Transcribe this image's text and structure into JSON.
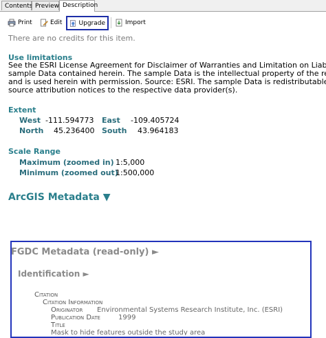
{
  "tabs": [
    {
      "label": "Contents"
    },
    {
      "label": "Preview"
    },
    {
      "label": "Description"
    }
  ],
  "toolbar": {
    "print": "Print",
    "edit": "Edit",
    "upgrade": "Upgrade",
    "import": "Import"
  },
  "credits_text": "There are no credits for this item.",
  "use_limitations": {
    "heading": "Use limitations",
    "lines": [
      "See the ESRI License Agreement for Disclaimer of Warranties and Limitation on Liabilities",
      "sample Data contained herein. The sample Data is the intellectual property of the respe",
      "and is used herein with permission. Source: ESRI. The sample Data is redistributable wit",
      "source attribution notices to the respective data provider(s)."
    ]
  },
  "extent": {
    "heading": "Extent",
    "west_label": "West",
    "west_value": "-111.594773",
    "east_label": "East",
    "east_value": "-109.405724",
    "north_label": "North",
    "north_value": "45.236400",
    "south_label": "South",
    "south_value": "43.964183"
  },
  "scale_range": {
    "heading": "Scale Range",
    "max_label": "Maximum (zoomed in)",
    "max_value": "1:5,000",
    "min_label": "Minimum (zoomed out)",
    "min_value": "1:500,000"
  },
  "arcgis_metadata": {
    "title": "ArcGIS Metadata",
    "arrow": "▼"
  },
  "fgdc": {
    "title": "FGDC Metadata (read-only)",
    "arrow": "►",
    "identification": "Identification",
    "identification_arrow": "►",
    "citation": "Citation",
    "citation_information": "Citation Information",
    "originator_label": "Originator",
    "originator_value": "Environmental Systems Research Institute, Inc. (ESRI)",
    "pubdate_label": "Publication Date",
    "pubdate_value": "1999",
    "title_label": "Title",
    "title_value": "Mask to hide features outside the study area"
  },
  "colors": {
    "highlight_border": "#1d2ea8",
    "heading_teal": "#2a7f8c"
  }
}
